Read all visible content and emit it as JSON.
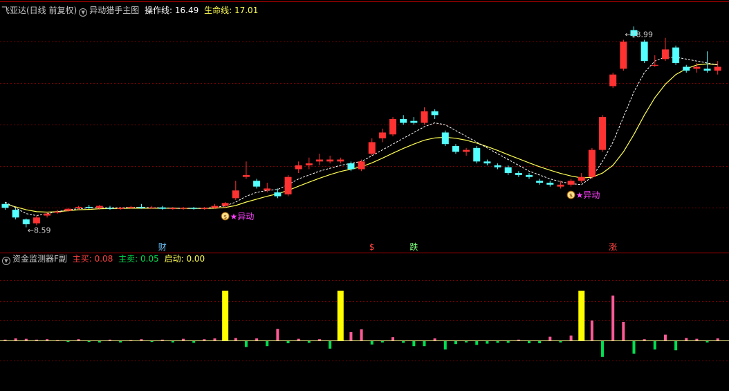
{
  "main_header": {
    "stock": "飞亚达(日线 前复权)",
    "indicator": "异动猎手主图",
    "op_label": "操作线:",
    "op_value": "16.49",
    "life_label": "生命线:",
    "life_value": "17.01"
  },
  "sub_header": {
    "indicator": "资金监测器F副",
    "buy_label": "主买:",
    "buy_value": "0.08",
    "sell_label": "主卖:",
    "sell_value": "0.05",
    "start_label": "启动:",
    "start_value": "0.00"
  },
  "colors": {
    "up": "#ff3232",
    "down": "#54ffff",
    "op_line": "#ffffff",
    "life_line": "#ffff54",
    "grid": "#7a0000",
    "signal": "#ff40ff",
    "bar_yellow": "#ffff00",
    "bar_pink": "#ff5a96",
    "bar_green": "#00e050"
  },
  "chart_data": [
    {
      "type": "candlestick",
      "title": "异动猎手主图",
      "annotations": [
        {
          "text": "18.99",
          "index": 59,
          "kind": "high"
        },
        {
          "text": "8.59",
          "index": 2,
          "kind": "low"
        }
      ],
      "signals": [
        {
          "index": 21,
          "text": "★异动"
        },
        {
          "index": 54,
          "text": "★异动"
        }
      ],
      "events": [
        {
          "index": 15,
          "text": "财",
          "color": "#6ec6ff"
        },
        {
          "index": 35,
          "text": "$",
          "color": "#ff4040"
        },
        {
          "index": 39,
          "text": "跌",
          "color": "#7cff7c"
        },
        {
          "index": 58,
          "text": "涨",
          "color": "#ff4040"
        }
      ],
      "candles": [
        [
          9.8,
          9.6,
          9.9,
          9.5
        ],
        [
          9.5,
          9.1,
          9.6,
          9.0
        ],
        [
          9.0,
          8.75,
          9.05,
          8.59
        ],
        [
          8.8,
          9.1,
          9.2,
          8.7
        ],
        [
          9.2,
          9.3,
          9.35,
          9.1
        ],
        [
          9.35,
          9.4,
          9.5,
          9.3
        ],
        [
          9.45,
          9.55,
          9.6,
          9.4
        ],
        [
          9.6,
          9.65,
          9.7,
          9.5
        ],
        [
          9.65,
          9.6,
          9.75,
          9.55
        ],
        [
          9.6,
          9.7,
          9.75,
          9.5
        ],
        [
          9.6,
          9.55,
          9.7,
          9.5
        ],
        [
          9.55,
          9.6,
          9.65,
          9.5
        ],
        [
          9.6,
          9.65,
          9.7,
          9.55
        ],
        [
          9.65,
          9.6,
          9.8,
          9.55
        ],
        [
          9.6,
          9.62,
          9.7,
          9.55
        ],
        [
          9.62,
          9.55,
          9.7,
          9.5
        ],
        [
          9.55,
          9.58,
          9.65,
          9.5
        ],
        [
          9.58,
          9.6,
          9.65,
          9.5
        ],
        [
          9.6,
          9.55,
          9.65,
          9.5
        ],
        [
          9.55,
          9.6,
          9.65,
          9.5
        ],
        [
          9.6,
          9.7,
          9.8,
          9.55
        ],
        [
          9.7,
          9.85,
          9.9,
          9.6
        ],
        [
          10.1,
          10.5,
          11.0,
          10.0
        ],
        [
          11.2,
          11.3,
          12.0,
          11.1
        ],
        [
          11.0,
          10.7,
          11.1,
          10.6
        ],
        [
          10.5,
          10.6,
          10.9,
          10.4
        ],
        [
          10.4,
          10.2,
          10.6,
          10.1
        ],
        [
          10.3,
          11.2,
          11.3,
          10.2
        ],
        [
          11.6,
          11.8,
          12.0,
          11.4
        ],
        [
          11.8,
          11.9,
          12.2,
          11.6
        ],
        [
          12.0,
          12.1,
          12.4,
          11.8
        ],
        [
          12.0,
          12.1,
          12.3,
          11.9
        ],
        [
          12.0,
          12.1,
          12.2,
          11.9
        ],
        [
          11.9,
          11.6,
          12.0,
          11.5
        ],
        [
          11.6,
          12.0,
          12.1,
          11.5
        ],
        [
          12.4,
          13.0,
          13.2,
          12.3
        ],
        [
          13.2,
          13.5,
          13.7,
          13.0
        ],
        [
          13.4,
          14.2,
          14.3,
          13.3
        ],
        [
          14.2,
          14.0,
          14.4,
          13.9
        ],
        [
          14.1,
          14.0,
          14.3,
          13.9
        ],
        [
          14.0,
          14.6,
          14.8,
          13.9
        ],
        [
          14.6,
          14.4,
          14.7,
          14.2
        ],
        [
          13.5,
          12.9,
          13.6,
          12.8
        ],
        [
          12.8,
          12.5,
          12.9,
          12.4
        ],
        [
          12.5,
          12.6,
          12.7,
          12.3
        ],
        [
          12.7,
          12.0,
          12.8,
          11.9
        ],
        [
          12.0,
          11.9,
          12.1,
          11.8
        ],
        [
          11.8,
          11.7,
          11.9,
          11.6
        ],
        [
          11.7,
          11.4,
          11.8,
          11.3
        ],
        [
          11.4,
          11.3,
          11.5,
          11.2
        ],
        [
          11.3,
          11.2,
          11.4,
          11.1
        ],
        [
          11.0,
          10.9,
          11.1,
          10.8
        ],
        [
          10.9,
          10.8,
          11.0,
          10.7
        ],
        [
          10.7,
          10.8,
          11.0,
          10.6
        ],
        [
          10.8,
          11.0,
          11.1,
          10.7
        ],
        [
          11.0,
          11.2,
          11.4,
          10.9
        ],
        [
          11.2,
          12.6,
          12.7,
          11.1
        ],
        [
          12.6,
          14.3,
          14.4,
          12.5
        ],
        [
          15.9,
          16.5,
          16.6,
          15.8
        ],
        [
          16.8,
          18.2,
          18.3,
          16.7
        ],
        [
          18.8,
          18.5,
          18.99,
          18.4
        ],
        [
          18.2,
          17.2,
          18.3,
          17.1
        ],
        [
          17.0,
          17.0,
          17.5,
          16.9
        ],
        [
          17.3,
          17.8,
          18.4,
          17.2
        ],
        [
          17.9,
          17.1,
          18.0,
          17.0
        ],
        [
          16.9,
          16.7,
          17.0,
          16.6
        ],
        [
          16.8,
          16.9,
          17.1,
          16.6
        ],
        [
          16.8,
          16.7,
          17.7,
          16.6
        ],
        [
          16.7,
          16.9,
          17.2,
          16.5
        ]
      ],
      "op_line": [
        9.9,
        9.6,
        9.3,
        9.2,
        9.3,
        9.4,
        9.5,
        9.55,
        9.6,
        9.6,
        9.6,
        9.6,
        9.62,
        9.62,
        9.61,
        9.6,
        9.58,
        9.58,
        9.58,
        9.58,
        9.62,
        9.7,
        9.9,
        10.2,
        10.4,
        10.5,
        10.55,
        10.8,
        11.1,
        11.3,
        11.5,
        11.65,
        11.8,
        11.9,
        12.0,
        12.3,
        12.6,
        12.9,
        13.2,
        13.5,
        13.8,
        14.0,
        13.9,
        13.6,
        13.3,
        13.0,
        12.7,
        12.4,
        12.1,
        11.8,
        11.5,
        11.3,
        11.1,
        10.95,
        10.85,
        10.8,
        11.2,
        12.0,
        13.0,
        14.3,
        15.6,
        16.6,
        17.2,
        17.4,
        17.4,
        17.3,
        17.2,
        17.1,
        17.0
      ],
      "life_line": [
        9.8,
        9.65,
        9.5,
        9.4,
        9.38,
        9.4,
        9.45,
        9.5,
        9.52,
        9.55,
        9.56,
        9.57,
        9.58,
        9.58,
        9.58,
        9.58,
        9.58,
        9.57,
        9.57,
        9.57,
        9.58,
        9.62,
        9.72,
        9.9,
        10.05,
        10.2,
        10.33,
        10.5,
        10.72,
        10.93,
        11.13,
        11.32,
        11.48,
        11.6,
        11.73,
        11.93,
        12.17,
        12.43,
        12.68,
        12.9,
        13.1,
        13.22,
        13.25,
        13.2,
        13.1,
        12.95,
        12.77,
        12.57,
        12.35,
        12.14,
        11.93,
        11.73,
        11.55,
        11.38,
        11.25,
        11.15,
        11.18,
        11.4,
        11.8,
        12.5,
        13.4,
        14.4,
        15.3,
        16.0,
        16.5,
        16.8,
        17.0,
        17.05,
        17.01
      ]
    },
    {
      "type": "bar",
      "title": "资金监测器F副",
      "series": [
        {
          "name": "主买",
          "color": "#ff5a96"
        },
        {
          "name": "主卖",
          "color": "#00e050"
        },
        {
          "name": "启动",
          "color": "#ffff00"
        }
      ],
      "bars": [
        [
          2,
          0,
          0
        ],
        [
          5,
          0,
          0
        ],
        [
          4,
          0,
          0
        ],
        [
          2,
          0,
          0
        ],
        [
          3,
          0,
          0
        ],
        [
          1,
          0,
          0
        ],
        [
          -2,
          0,
          0
        ],
        [
          3,
          0,
          0
        ],
        [
          -2,
          0,
          0
        ],
        [
          -3,
          0,
          0
        ],
        [
          2,
          0,
          0
        ],
        [
          -3,
          0,
          0
        ],
        [
          1,
          0,
          0
        ],
        [
          3,
          0,
          0
        ],
        [
          -2,
          0,
          0
        ],
        [
          2,
          0,
          0
        ],
        [
          -3,
          0,
          0
        ],
        [
          4,
          0,
          0
        ],
        [
          -4,
          0,
          0
        ],
        [
          3,
          0,
          0
        ],
        [
          5,
          0,
          0
        ],
        [
          0,
          1,
          72
        ],
        [
          6,
          0,
          0
        ],
        [
          -14,
          0,
          0
        ],
        [
          5,
          0,
          0
        ],
        [
          -12,
          0,
          0
        ],
        [
          28,
          0,
          0
        ],
        [
          -5,
          0,
          0
        ],
        [
          4,
          0,
          0
        ],
        [
          -4,
          0,
          0
        ],
        [
          3,
          0,
          0
        ],
        [
          -18,
          0,
          0
        ],
        [
          0,
          1,
          72
        ],
        [
          20,
          0,
          0
        ],
        [
          27,
          0,
          0
        ],
        [
          -8,
          0,
          0
        ],
        [
          -3,
          0,
          0
        ],
        [
          8,
          0,
          0
        ],
        [
          -4,
          0,
          0
        ],
        [
          -12,
          0,
          0
        ],
        [
          -12,
          0,
          0
        ],
        [
          5,
          0,
          0
        ],
        [
          -20,
          0,
          0
        ],
        [
          -7,
          0,
          0
        ],
        [
          -3,
          0,
          0
        ],
        [
          -9,
          0,
          0
        ],
        [
          -6,
          0,
          0
        ],
        [
          -4,
          0,
          0
        ],
        [
          -4,
          0,
          0
        ],
        [
          2,
          0,
          0
        ],
        [
          -5,
          0,
          0
        ],
        [
          -5,
          0,
          0
        ],
        [
          9,
          0,
          0
        ],
        [
          -3,
          0,
          0
        ],
        [
          12,
          0,
          0
        ],
        [
          0,
          1,
          72
        ],
        [
          48,
          0,
          0
        ],
        [
          -38,
          0,
          0
        ],
        [
          108,
          0,
          0
        ],
        [
          45,
          0,
          0
        ],
        [
          -30,
          0,
          0
        ],
        [
          3,
          0,
          0
        ],
        [
          -20,
          0,
          0
        ],
        [
          14,
          0,
          0
        ],
        [
          -22,
          0,
          0
        ],
        [
          6,
          0,
          0
        ],
        [
          4,
          0,
          0
        ],
        [
          -3,
          0,
          0
        ],
        [
          5,
          0,
          0
        ]
      ]
    }
  ]
}
